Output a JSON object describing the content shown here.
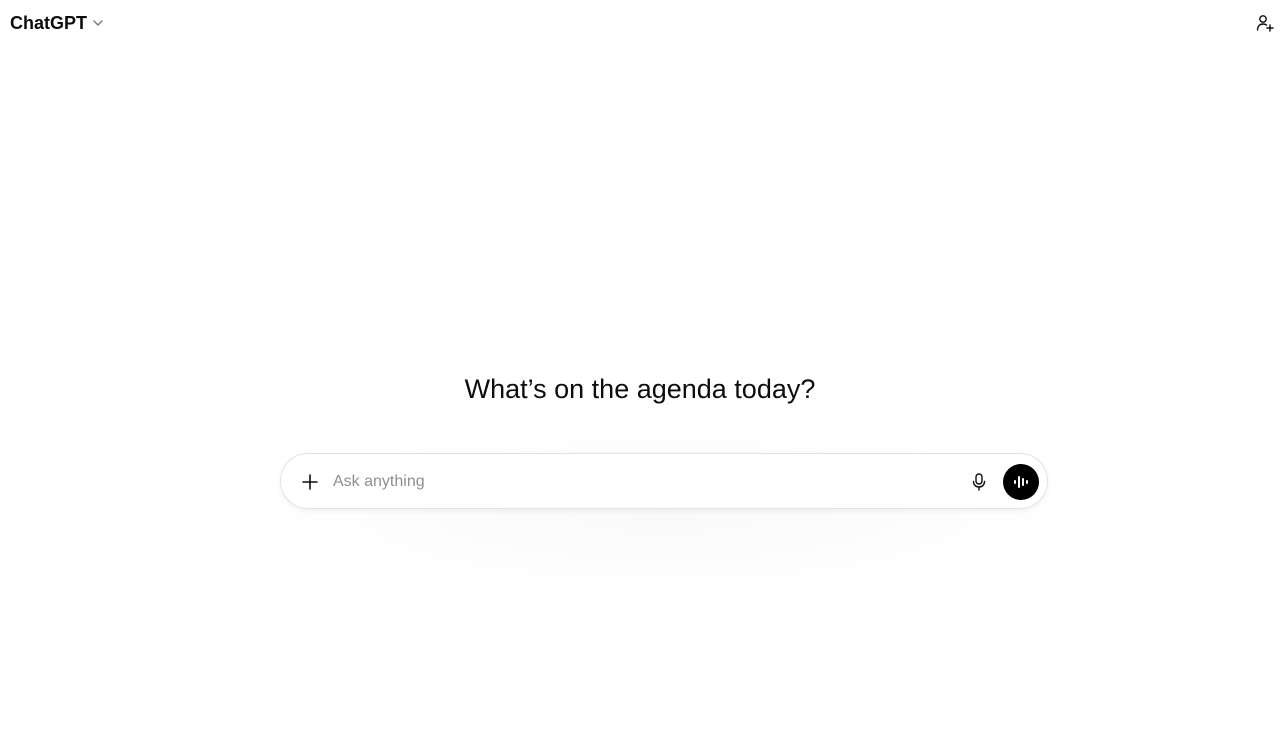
{
  "header": {
    "model_name": "ChatGPT",
    "model_chevron_icon": "chevron-down-icon",
    "share_icon": "add-user-icon"
  },
  "main": {
    "headline": "What’s on the agenda today?"
  },
  "composer": {
    "placeholder": "Ask anything",
    "value": "",
    "plus_icon": "plus-icon",
    "mic_icon": "microphone-icon",
    "voice_icon": "voice-waveform-icon"
  },
  "colors": {
    "background": "#ffffff",
    "text": "#0d0d0d",
    "placeholder": "#8f8f8f",
    "composer_border": "#e3e3e3",
    "voice_button": "#000000"
  }
}
